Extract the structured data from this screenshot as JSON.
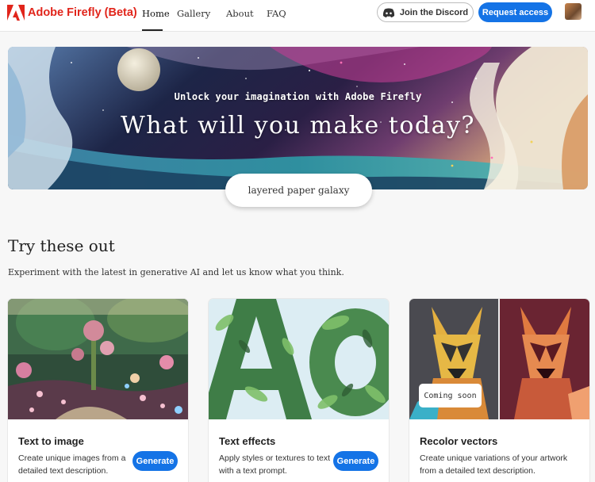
{
  "header": {
    "brand": "Adobe Firefly (Beta)",
    "nav": [
      "Home",
      "Gallery",
      "About",
      "FAQ"
    ],
    "active_nav": "Home",
    "discord_label": "Join the Discord",
    "request_label": "Request access",
    "brand_color": "#e1251b",
    "accent_color": "#1473e6"
  },
  "hero": {
    "subtitle": "Unlock your imagination with Adobe Firefly",
    "title": "What will you make today?",
    "prompt_value": "layered paper galaxy"
  },
  "section": {
    "title": "Try these out",
    "description": "Experiment with the latest in generative AI and let us know what you think."
  },
  "cards": [
    {
      "title": "Text to image",
      "description": "Create unique images from a detailed text description.",
      "button": "Generate"
    },
    {
      "title": "Text effects",
      "description": "Apply styles or textures to text with a text prompt.",
      "button": "Generate"
    },
    {
      "title": "Recolor vectors",
      "description": "Create unique variations of your artwork from a detailed text description.",
      "badge": "Coming soon"
    }
  ]
}
